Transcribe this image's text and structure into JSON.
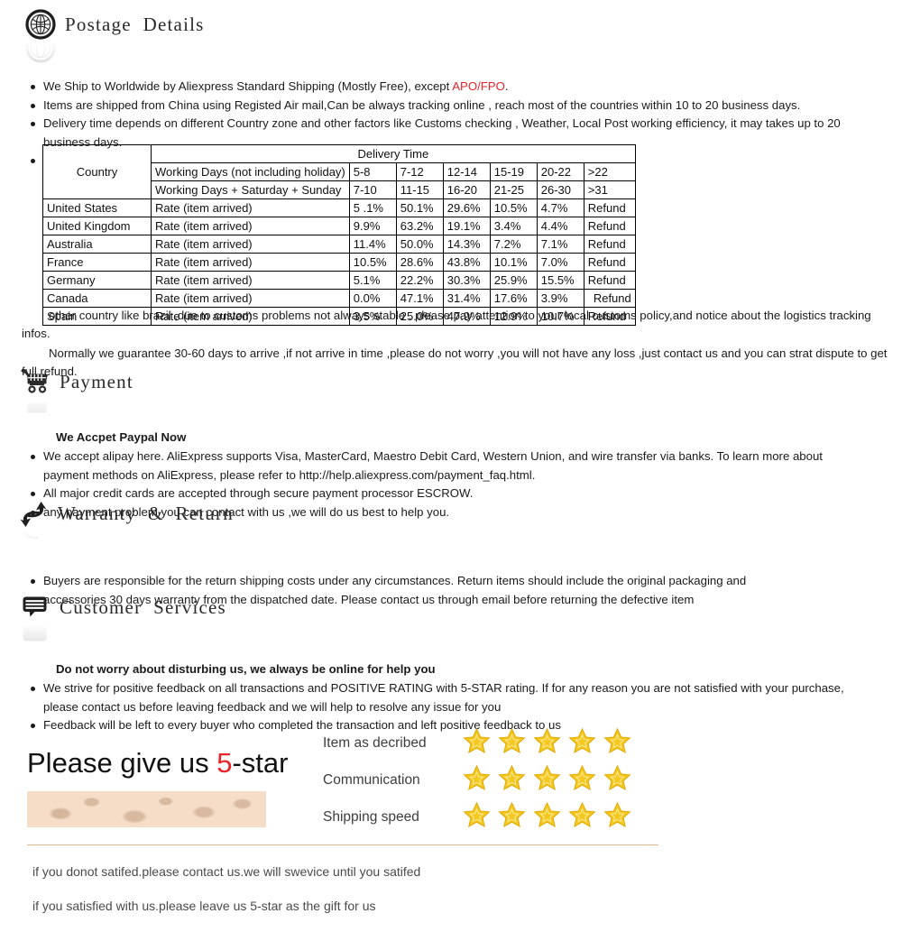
{
  "sections": {
    "postage": {
      "icon": "globe-icon",
      "title": "Postage  Details",
      "bullets": [
        {
          "pre": "We Ship to Worldwide by Aliexpress Standard Shipping (Mostly Free), except ",
          "highlight": "APO/FPO",
          "post": "."
        },
        {
          "pre": "Items are shipped from China using Registed Air mail,Can be always tracking online , reach most of the countries within 10 to 20 business days.",
          "highlight": "",
          "post": ""
        },
        {
          "pre": "Delivery time depends on different Country zone and other factors like Customs checking , Weather, Local Post working efficiency, it may takes up to 20 business days.",
          "highlight": "",
          "post": ""
        }
      ],
      "note_1": "other country like brazil ,due to customs problems not always stable . please pay attention to your local customs policy,and notice about the logistics tracking infos.",
      "note_2": "Normally we guarantee 30-60 days to arrive ,if not arrive in time ,please do not worry ,you will not have any loss ,just contact us and you can strat dispute to get full refund."
    },
    "payment": {
      "icon": "cart-icon",
      "title": "Payment",
      "subheading": "We Accpet Paypal Now",
      "bullets": [
        " We accept alipay here. AliExpress supports Visa, MasterCard, Maestro Debit Card, Western Union, and wire transfer via banks. To learn more about payment methods on AliExpress, please refer to http://help.aliexpress.com/payment_faq.html.",
        "All major credit cards are accepted through secure payment processor ESCROW.",
        "any payment problem you can contact with us ,we will do us best to help you."
      ]
    },
    "warranty": {
      "icon": "exchange-arrows-icon",
      "title": "Warranty  &  Return",
      "bullets": [
        "Buyers are responsible for the return shipping costs under any circumstances. Return items should include the original packaging and accessories 30 days warranty from the dispatched date. Please contact us through email before returning the defective item"
      ]
    },
    "customer_services": {
      "icon": "speech-bubble-icon",
      "title": "Customer  Services",
      "subheading": "Do not worry about disturbing us, we always be online for help you",
      "bullets": [
        "We strive for positive feedback on all transactions and POSITIVE RATING with 5-STAR rating. If for any reason you are not satisfied with your purchase, please contact us before leaving feedback and we will help to resolve any issue for you",
        "Feedback will be left to every buyer who completed the transaction and left positive feedback to us"
      ]
    }
  },
  "delivery_table": {
    "caption": "Delivery Time",
    "country_header": "Country",
    "row_labels": {
      "working_days": "Working Days (not including holiday)",
      "working_days_weekend": "Working Days + Saturday + Sunday",
      "rate": "Rate (item arrived)"
    },
    "day_ranges_working": [
      "5-8",
      "7-12",
      "12-14",
      "15-19",
      "20-22",
      ">22"
    ],
    "day_ranges_all": [
      "7-10",
      "11-15",
      "16-20",
      "21-25",
      "26-30",
      ">31"
    ],
    "rows": [
      {
        "country": "United States",
        "values": [
          "5 .1%",
          "50.1%",
          "29.6%",
          "10.5%",
          "4.7%",
          "Refund"
        ],
        "refund_align": "left"
      },
      {
        "country": "United Kingdom",
        "values": [
          "9.9%",
          "63.2%",
          "19.1%",
          "3.4%",
          "4.4%",
          "Refund"
        ],
        "refund_align": "left"
      },
      {
        "country": "Australia",
        "values": [
          "11.4%",
          "50.0%",
          "14.3%",
          "7.2%",
          "7.1%",
          "Refund"
        ],
        "refund_align": "left"
      },
      {
        "country": "France",
        "values": [
          "10.5%",
          "28.6%",
          "43.8%",
          "10.1%",
          "7.0%",
          "Refund"
        ],
        "refund_align": "left"
      },
      {
        "country": "Germany",
        "values": [
          "5.1%",
          "22.2%",
          "30.3%",
          "25.9%",
          "15.5%",
          "Refund"
        ],
        "refund_align": "left"
      },
      {
        "country": "Canada",
        "values": [
          "0.0%",
          "47.1%",
          "31.4%",
          "17.6%",
          "3.9%",
          "Refund"
        ],
        "refund_align": "right"
      },
      {
        "country": "Spain",
        "values": [
          "3.5%",
          "25.0%",
          "47.9%",
          "12.9%",
          "10.7%",
          "Refund"
        ],
        "refund_align": "left"
      }
    ]
  },
  "banner": {
    "headline_pre": "Please give us ",
    "headline_num": "5",
    "headline_post": "-star",
    "ratings": [
      {
        "label": "Item as decribed",
        "stars": 5
      },
      {
        "label": "Communication",
        "stars": 5
      },
      {
        "label": "Shipping speed",
        "stars": 5
      }
    ],
    "footer_lines": [
      "if you donot satifed.please contact us.we will swevice until you satifed",
      "if you satisfied with us.please leave us 5-star as the gift for us"
    ]
  },
  "colors": {
    "highlight_red": "#e8252a",
    "star_gold": "#f2c21a",
    "star_gold_dark": "#d9a400",
    "ornament_bg": "#f6ddc8",
    "rule": "#d9b98a"
  }
}
